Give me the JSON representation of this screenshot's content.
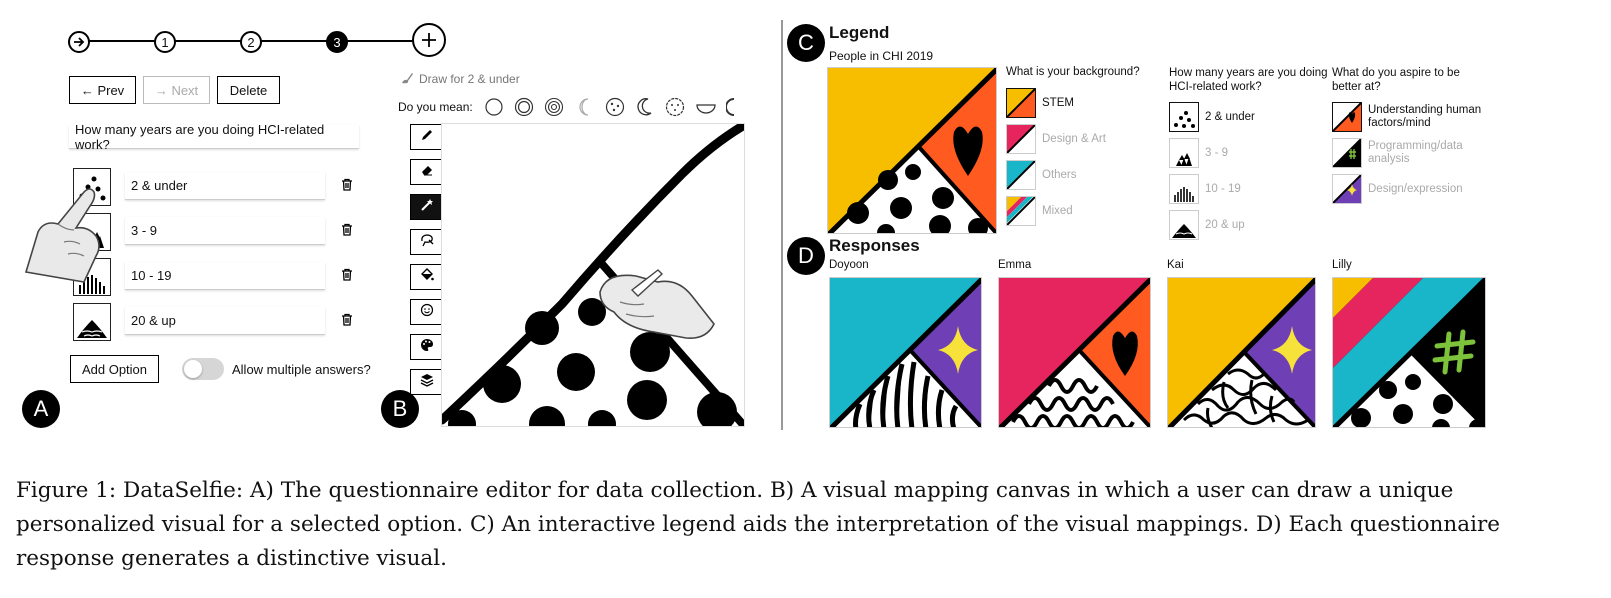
{
  "panel_a": {
    "badge": "A",
    "steps": [
      "1",
      "2",
      "3"
    ],
    "prev_label": "← Prev",
    "next_label": "→ Next",
    "delete_label": "Delete",
    "question": "How many years are you doing HCI-related work?",
    "options": [
      "2 & under",
      "3 - 9",
      "10 - 19",
      "20 & up"
    ],
    "add_option_label": "Add Option",
    "allow_multiple_label": "Allow multiple answers?"
  },
  "panel_b": {
    "badge": "B",
    "draw_for": "Draw for 2 & under",
    "do_you_mean": "Do you mean:"
  },
  "panel_c": {
    "badge": "C",
    "title": "Legend",
    "subtitle": "People in CHI 2019",
    "q1": "What is your background?",
    "q1_options": [
      "STEM",
      "Design & Art",
      "Others",
      "Mixed"
    ],
    "q2": "How many years are you doing HCI-related work?",
    "q2_options": [
      "2 & under",
      "3 - 9",
      "10 - 19",
      "20 & up"
    ],
    "q3": "What do you aspire to be better at?",
    "q3_options": [
      "Understanding human factors/mind",
      "Programming/data analysis",
      "Design/expression"
    ]
  },
  "panel_d": {
    "badge": "D",
    "title": "Responses",
    "names": [
      "Doyoon",
      "Emma",
      "Kai",
      "Lilly"
    ]
  },
  "colors": {
    "yellow": "#F7BE00",
    "orange": "#FF5A1F",
    "cyan": "#19B5C8",
    "pink": "#E6245E",
    "purple": "#6E3FB5",
    "star_yellow": "#F7E23B",
    "green": "#7CC23B"
  },
  "caption": "Figure 1: DataSelfie: A) The questionnaire editor for data collection. B) A visual mapping canvas in which a user can draw a unique personalized visual for a selected option. C) An interactive legend aids the interpretation of the visual mappings. D) Each questionnaire response generates a distinctive visual."
}
